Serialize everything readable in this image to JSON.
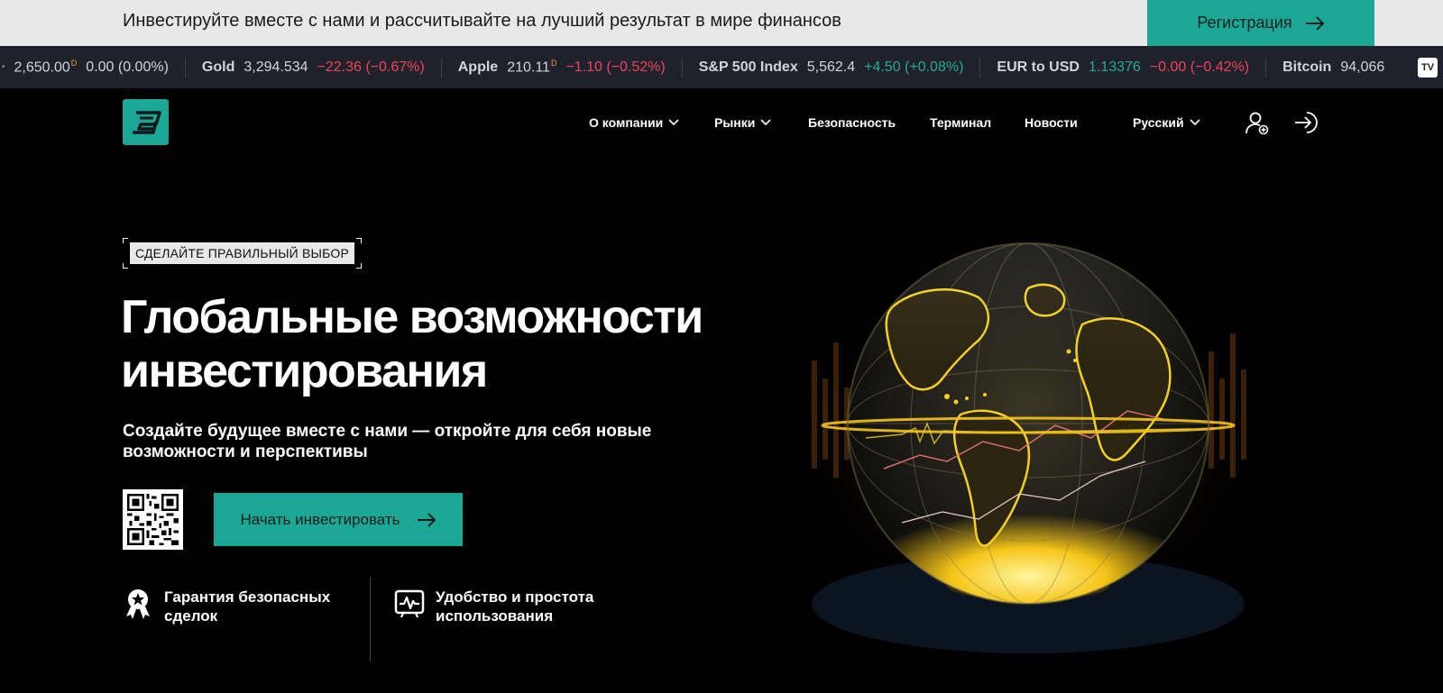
{
  "promo": {
    "text": "Инвестируйте вместе с нами и рассчитывайте на лучший результат в мире финансов",
    "button_label": "Регистрация"
  },
  "ticker": [
    {
      "name": "",
      "price": "2,650.00",
      "flag": "D",
      "change": "0.00 (0.00%)",
      "dir": "neu"
    },
    {
      "name": "Gold",
      "price": "3,294.534",
      "flag": "",
      "change": "−22.36 (−0.67%)",
      "dir": "neg"
    },
    {
      "name": "Apple",
      "price": "210.11",
      "flag": "D",
      "change": "−1.10 (−0.52%)",
      "dir": "neg"
    },
    {
      "name": "S&P 500 Index",
      "price": "5,562.4",
      "flag": "",
      "change": "+4.50 (+0.08%)",
      "dir": "pos"
    },
    {
      "name": "EUR to USD",
      "price": "1.13376",
      "flag": "",
      "change": "−0.00 (−0.42%)",
      "dir": "neg",
      "price_dir": "pos"
    },
    {
      "name": "Bitcoin",
      "price": "94,066",
      "flag": "",
      "change": "",
      "dir": "neu"
    }
  ],
  "ticker_logo": "TV",
  "nav": {
    "items": [
      {
        "label": "О компании",
        "dropdown": true
      },
      {
        "label": "Рынки",
        "dropdown": true
      },
      {
        "label": "Безопасность",
        "dropdown": false
      },
      {
        "label": "Терминал",
        "dropdown": false
      },
      {
        "label": "Новости",
        "dropdown": false
      }
    ],
    "language": "Русский"
  },
  "hero": {
    "badge": "СДЕЛАЙТЕ ПРАВИЛЬНЫЙ ВЫБОР",
    "title_line1": "Глобальные возможности",
    "title_line2": "инвестирования",
    "subtitle_line1": "Создайте будущее вместе с нами — откройте для себя новые",
    "subtitle_line2": "возможности и перспективы",
    "cta_label": "Начать инвестировать"
  },
  "features": [
    {
      "label_line1": "Гарантия безопасных",
      "label_line2": "сделок",
      "icon": "award-badge-icon"
    },
    {
      "label_line1": "Удобство и простота",
      "label_line2": "использования",
      "icon": "monitor-chart-icon"
    }
  ],
  "colors": {
    "accent": "#1ba796",
    "banner_bg": "#e8e8e8",
    "ticker_bg": "#1f222b",
    "negative": "#f0435a",
    "positive": "#22ab94",
    "globe_glow": "#f5c518"
  }
}
